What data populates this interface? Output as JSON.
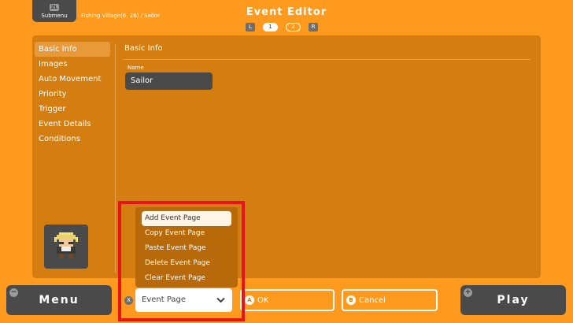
{
  "header": {
    "submenu_key": "ZL",
    "submenu_label": "Submenu",
    "breadcrumb": "Fishing Village(6, 26) / Sailor",
    "title": "Event Editor",
    "pager": {
      "left_key": "L",
      "pages": [
        "1",
        "2"
      ],
      "active_page": "1",
      "right_key": "R"
    }
  },
  "sidebar": {
    "items": [
      {
        "label": "Basic Info",
        "selected": true
      },
      {
        "label": "Images"
      },
      {
        "label": "Auto Movement"
      },
      {
        "label": "Priority"
      },
      {
        "label": "Trigger"
      },
      {
        "label": "Event Details"
      },
      {
        "label": "Conditions"
      }
    ]
  },
  "main": {
    "section_title": "Basic Info",
    "name_label": "Name",
    "name_value": "Sailor"
  },
  "dropdown": {
    "items": [
      {
        "label": "Add Event Page",
        "highlighted": true
      },
      {
        "label": "Copy Event Page"
      },
      {
        "label": "Paste Event Page"
      },
      {
        "label": "Delete Event Page"
      },
      {
        "label": "Clear Event Page"
      }
    ],
    "selected_value": "Event Page",
    "key_badge": "X"
  },
  "footer": {
    "menu_label": "Menu",
    "menu_key": "−",
    "ok_label": "OK",
    "ok_key": "A",
    "cancel_label": "Cancel",
    "cancel_key": "B",
    "play_label": "Play",
    "play_key": "+"
  },
  "colors": {
    "background": "#ff9a1f",
    "panel": "#d47e12",
    "dark_button": "#4a4a4a",
    "highlight_box": "#e8141c"
  }
}
